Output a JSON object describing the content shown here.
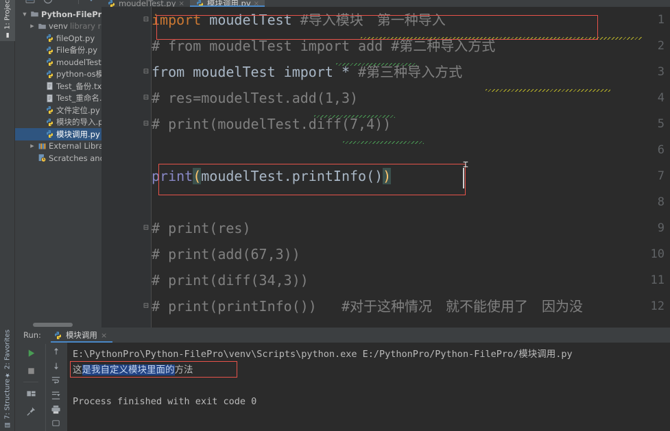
{
  "window": {
    "theme_bg": "#3C3F41",
    "editor_bg": "#2B2B2B",
    "accent": "#4A88C7",
    "highlight_box": "#E8534A",
    "selection": "#214283"
  },
  "left_tool_strip": {
    "tabs": [
      {
        "label": "1: Project",
        "icon": "project-icon",
        "active": true
      },
      {
        "label": "2: Favorites",
        "icon": "star-icon",
        "active": false
      },
      {
        "label": "7: Structure",
        "icon": "structure-icon",
        "active": false
      }
    ]
  },
  "toolbar": {
    "icons": [
      "open-file-icon",
      "sync-icon",
      "up-icon",
      "download-icon"
    ]
  },
  "project_tree": {
    "items": [
      {
        "label": "Python-FilePro",
        "sub": "",
        "depth": 0,
        "icon": "folder-icon",
        "arrow": "▼",
        "selected": false,
        "root": true
      },
      {
        "label": "venv",
        "sub": "library r",
        "depth": 1,
        "icon": "folder-icon",
        "arrow": "▶",
        "selected": false,
        "root": false
      },
      {
        "label": "fileOpt.py",
        "sub": "",
        "depth": 2,
        "icon": "python-icon",
        "arrow": "",
        "selected": false,
        "root": false
      },
      {
        "label": "File备份.py",
        "sub": "",
        "depth": 2,
        "icon": "python-icon",
        "arrow": "",
        "selected": false,
        "root": false
      },
      {
        "label": "moudelTest.py",
        "sub": "",
        "depth": 2,
        "icon": "python-icon",
        "arrow": "",
        "selected": false,
        "root": false
      },
      {
        "label": "python-os模块",
        "sub": "",
        "depth": 2,
        "icon": "python-icon",
        "arrow": "",
        "selected": false,
        "root": false
      },
      {
        "label": "Test_备份.txt",
        "sub": "",
        "depth": 2,
        "icon": "text-icon",
        "arrow": "",
        "selected": false,
        "root": false
      },
      {
        "label": "Test_重命名.txt",
        "sub": "",
        "depth": 2,
        "icon": "text-icon",
        "arrow": "",
        "selected": false,
        "root": false
      },
      {
        "label": "文件定位.py",
        "sub": "",
        "depth": 2,
        "icon": "python-icon",
        "arrow": "",
        "selected": false,
        "root": false
      },
      {
        "label": "模块的导入.py",
        "sub": "",
        "depth": 2,
        "icon": "python-icon",
        "arrow": "",
        "selected": false,
        "root": false
      },
      {
        "label": "模块调用.py",
        "sub": "",
        "depth": 2,
        "icon": "python-icon",
        "arrow": "",
        "selected": true,
        "root": false
      },
      {
        "label": "External Libraries",
        "sub": "",
        "depth": 1,
        "icon": "libraries-icon",
        "arrow": "▶",
        "selected": false,
        "root": false
      },
      {
        "label": "Scratches and Co",
        "sub": "",
        "depth": 1,
        "icon": "scratches-icon",
        "arrow": "",
        "selected": false,
        "root": false
      }
    ]
  },
  "editor_tabs": [
    {
      "label": "moudelTest.py",
      "icon": "python-icon",
      "active": false,
      "close": "×"
    },
    {
      "label": "模块调用.py",
      "icon": "python-icon",
      "active": true,
      "close": "×"
    }
  ],
  "editor": {
    "line_numbers": [
      "1",
      "2",
      "3",
      "4",
      "5",
      "6",
      "7",
      "8",
      "9",
      "10",
      "11",
      "12"
    ],
    "lines": [
      {
        "num": "1",
        "fold": "⊟",
        "tokens": [
          {
            "t": "import",
            "c": "kw"
          },
          {
            "t": " moudelTest ",
            "c": "id"
          },
          {
            "t": "#导入模块　第一种导入",
            "c": "cmt"
          }
        ]
      },
      {
        "num": "2",
        "fold": "",
        "tokens": [
          {
            "t": "# from moudelTest import add #第二种导入方式",
            "c": "cmt"
          }
        ]
      },
      {
        "num": "3",
        "fold": "⊟",
        "tokens": [
          {
            "t": "from moudelTest import * ",
            "c": "id"
          },
          {
            "t": "#第三种导入方式",
            "c": "cmt"
          }
        ]
      },
      {
        "num": "4",
        "fold": "⊟",
        "tokens": [
          {
            "t": "# res=moudelTest.add(1,3)",
            "c": "cmt"
          }
        ]
      },
      {
        "num": "5",
        "fold": "⊟",
        "tokens": [
          {
            "t": "# print(moudelTest.diff(7,4))",
            "c": "cmt"
          }
        ]
      },
      {
        "num": "6",
        "fold": "",
        "tokens": []
      },
      {
        "num": "7",
        "fold": "",
        "tokens": [
          {
            "t": "print",
            "c": "fn"
          },
          {
            "t": "(",
            "c": "par"
          },
          {
            "t": "moudelTest.printInfo()",
            "c": "id"
          },
          {
            "t": ")",
            "c": "par"
          }
        ]
      },
      {
        "num": "8",
        "fold": "",
        "tokens": []
      },
      {
        "num": "9",
        "fold": "⊟",
        "tokens": [
          {
            "t": "# print(res)",
            "c": "cmt"
          }
        ]
      },
      {
        "num": "10",
        "fold": "",
        "tokens": [
          {
            "t": "# print(add(67,3))",
            "c": "cmt"
          }
        ]
      },
      {
        "num": "11",
        "fold": "",
        "tokens": [
          {
            "t": "# print(diff(34,3))",
            "c": "cmt"
          }
        ]
      },
      {
        "num": "12",
        "fold": "⊟",
        "tokens": [
          {
            "t": "# print(printInfo())   #对于这种情况　就不能使用了　因为没",
            "c": "cmt"
          }
        ]
      }
    ]
  },
  "run_panel": {
    "label": "Run:",
    "tab_label": "模块调用",
    "tab_icon": "python-icon",
    "tab_close": "×",
    "toolbar_left": [
      "run-icon",
      "stop-icon",
      "layout-icon",
      "pin-icon"
    ],
    "toolbar_right": [
      "up-arrow-icon",
      "down-arrow-icon",
      "soft-wrap-icon",
      "scroll-to-end-icon",
      "print-icon"
    ],
    "console": {
      "command": "E:\\PythonPro\\Python-FilePro\\venv\\Scripts\\python.exe E:/PythonPro/Python-FilePro/模块调用.py",
      "output_pre": "这",
      "output_selected": "是我自定义模块里面的",
      "output_post": "方法",
      "blank": "",
      "exit_line": "Process finished with exit code 0"
    }
  }
}
